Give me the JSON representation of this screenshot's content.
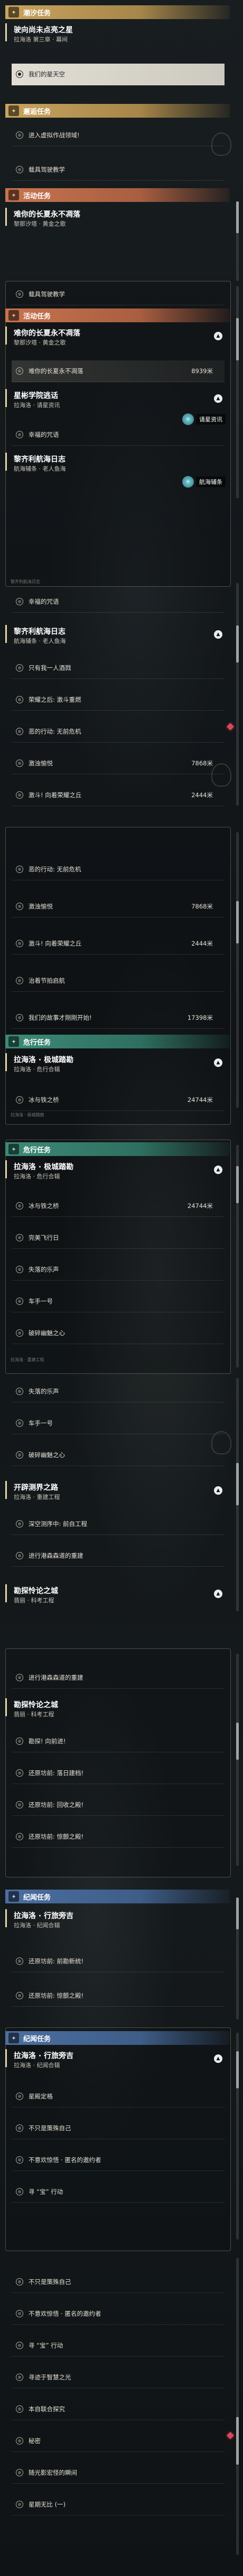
{
  "sections": {
    "tidal": {
      "label": "潮汐任务",
      "icon": "✦"
    },
    "encounter": {
      "label": "邂逅任务",
      "icon": "✦"
    },
    "activity": {
      "label": "活动任务",
      "icon": "✦"
    },
    "danger": {
      "label": "危行任务",
      "icon": "✦"
    },
    "danger2": {
      "label": "危行任务",
      "icon": "✦"
    },
    "activity2": {
      "label": "活动任务",
      "icon": "✦"
    },
    "jihang": {
      "label": "纪闻任务",
      "icon": "✦"
    },
    "jihang2": {
      "label": "纪闻任务",
      "icon": "✦"
    }
  },
  "quests": {
    "q1": {
      "title": "驶向尚未点亮之星",
      "sub": "拉海洛 第三章 · 幕间"
    },
    "q2": {
      "title": "难你的长夏永不凋落",
      "sub": "黎那汐塔 · 黄金之歌"
    },
    "q2b": {
      "title": "难你的长夏永不凋落",
      "sub": "黎那汐塔 · 黄金之歌"
    },
    "q3": {
      "title": "星彬学院逃话",
      "sub": "拉海洛 · 请星资讯"
    },
    "q4": {
      "title": "黎齐利航海日志",
      "sub": "航海辅条 · 老人鱼海"
    },
    "q4b": {
      "title": "黎齐利航海日志",
      "sub": "航海辅条 · 老人鱼海"
    },
    "q5": {
      "title": "拉海洛 · 极城踏勘",
      "sub": "拉海洛 · 危行合辑"
    },
    "q6": {
      "title": "拉海洛 · 极城踏勘",
      "sub": "拉海洛 · 危行合辑"
    },
    "q7": {
      "title": "开辟测界之路",
      "sub": "拉海洛 · 重建工程"
    },
    "q8": {
      "title": "勘探怜论之城",
      "sub": "翡丽 · 科考工程"
    },
    "q8b": {
      "title": "勘探怜论之城",
      "sub": "翡丽 · 科考工程"
    },
    "q9": {
      "title": "拉海洛 · 行旅旁吉",
      "sub": "拉海洛 · 纪闻合辑"
    },
    "q10": {
      "title": "拉海洛 · 行旅旁吉",
      "sub": "拉海洛 · 纪闻合辑"
    }
  },
  "rows": {
    "r_go": {
      "text": "我们的星天空"
    },
    "r_e1": {
      "text": "进入虚拟作战领域!"
    },
    "r_e2": {
      "text": "载具驾驶教学"
    },
    "r_e3": {
      "text": "载具驾驶教学"
    },
    "r_a1": {
      "text": "难你的长夏永不凋落",
      "dist": "8939米"
    },
    "r_a2": {
      "text": "幸福的咒语"
    },
    "r_a3": {
      "text": "幸福的咒语"
    },
    "r_a4": {
      "text": "只有我一人酒戮"
    },
    "r_a5": {
      "text": "荣耀之后: 激斗重燃"
    },
    "r_a6": {
      "text": "恶的行动: 无前危机"
    },
    "r_a7": {
      "text": "激浊愉悦",
      "dist": "7868米"
    },
    "r_a8": {
      "text": "激斗! 向着荣耀之丘",
      "dist": "2444米"
    },
    "r_b1": {
      "text": "恶的行动: 无前危机"
    },
    "r_b2": {
      "text": "激浊愉悦",
      "dist": "7868米"
    },
    "r_b3": {
      "text": "激斗! 向着荣耀之丘",
      "dist": "2444米"
    },
    "r_b4": {
      "text": "治着节拍启航"
    },
    "r_b5": {
      "text": "我们的故事才刚刚开始!",
      "dist": "17398米"
    },
    "r_c1": {
      "text": "冰与铁之桥",
      "dist": "24744米"
    },
    "r_d1": {
      "text": "冰与铁之桥",
      "dist": "24744米"
    },
    "r_d2": {
      "text": "完美飞行日"
    },
    "r_d3": {
      "text": "失落的乐声"
    },
    "r_d4": {
      "text": "车手一号"
    },
    "r_d5": {
      "text": "破碎幽魅之心"
    },
    "r_d6": {
      "text": "失落的乐声"
    },
    "r_d7": {
      "text": "车手一号"
    },
    "r_d8": {
      "text": "破碎幽魅之心"
    },
    "r_f1": {
      "text": "深空测序中: 前自工程"
    },
    "r_f2": {
      "text": "进行港森森道的重建"
    },
    "r_g1": {
      "text": "进行港森森道的重建"
    },
    "r_g2": {
      "text": "勘探! 向前进!"
    },
    "r_g3": {
      "text": "还原坊前: 落日建档!"
    },
    "r_g4": {
      "text": "还原坊前: 回收之殿!"
    },
    "r_g5": {
      "text": "还原坊前: 惊颤之殿!"
    },
    "r_h1": {
      "text": "还原坊前: 前勘新统!"
    },
    "r_h2": {
      "text": "还原坊前: 惊颤之殿!"
    },
    "r_i1": {
      "text": "星殿定格"
    },
    "r_i2": {
      "text": "不只是策殊自己"
    },
    "r_i3": {
      "text": "不意欢惊悟 · 匿名的邀约者"
    },
    "r_i4": {
      "text": "寻 “宝” 行动"
    },
    "r_j1": {
      "text": "不只是策殊自己"
    },
    "r_j2": {
      "text": "不意欢惊悟 · 匿名的邀约者"
    },
    "r_j3": {
      "text": "寻 “宝” 行动"
    },
    "r_j4": {
      "text": "寻迹于智慧之光"
    },
    "r_j5": {
      "text": "本自联合探究"
    },
    "r_j6": {
      "text": "秘密"
    },
    "r_j7": {
      "text": "随光影宏怪的瞬间"
    },
    "r_j8": {
      "text": "星期无比 (一)"
    }
  },
  "chips": {
    "c1": {
      "icon": "✧",
      "label": "请星资讯"
    },
    "c2": {
      "icon": "✧",
      "label": "航海辅条"
    },
    "c3": {
      "icon": "✧",
      "label": "请星资讯"
    }
  },
  "decor": {
    "tiny1": "黎齐利航海日志",
    "tiny2": "拉海洛 · 极城踏勘",
    "tiny3": "拉海洛 · 重建工程"
  },
  "colors": {
    "tidal": "#c9a45e",
    "activity": "#c8744e",
    "danger": "#3d8a77",
    "jihang": "#4c6fa0",
    "marker": "#d8475a"
  }
}
